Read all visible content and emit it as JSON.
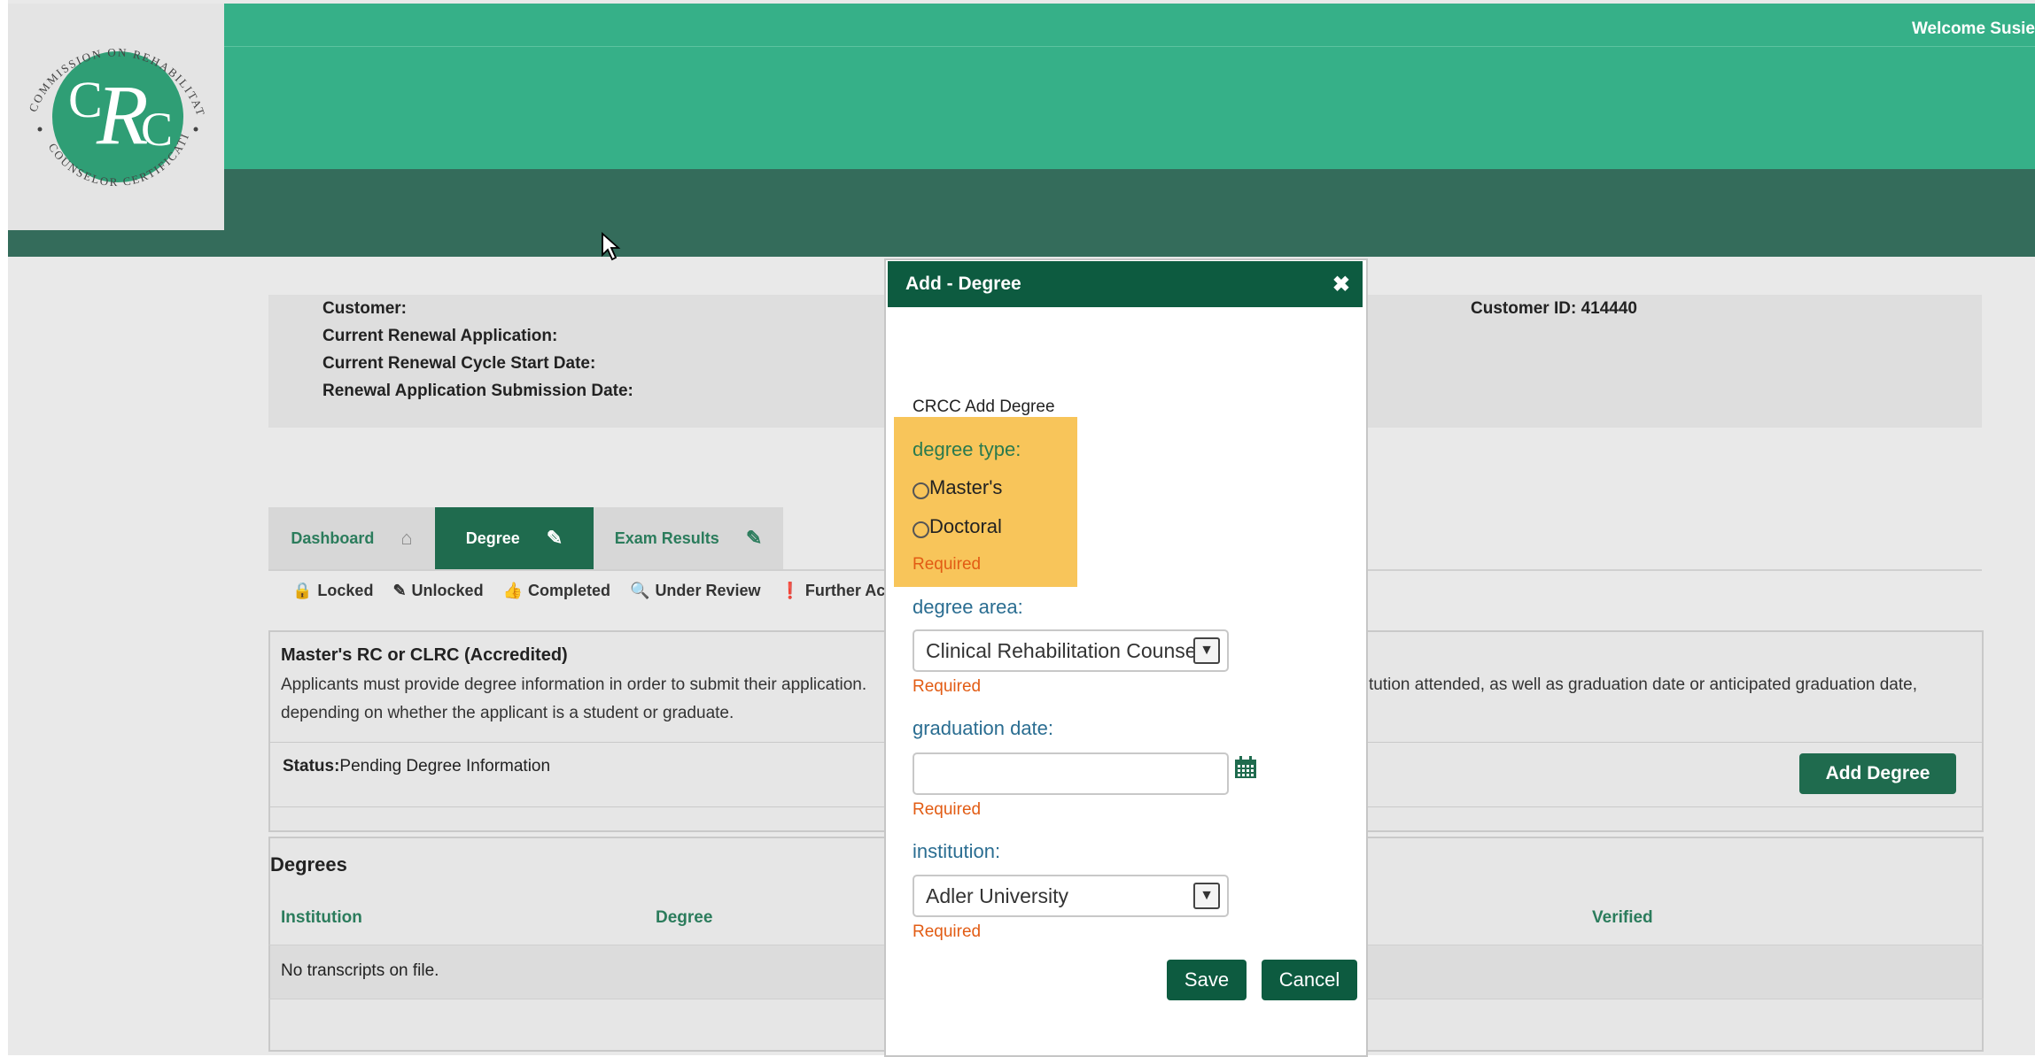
{
  "header": {
    "welcome": "Welcome Susie",
    "logo": {
      "top_text": "COMMISSION ON REHABILITATION",
      "bottom_text": "COUNSELOR CERTIFICATION",
      "monogram": "CRC",
      "colors": {
        "circle": "#2f9e75",
        "text": "#ffffff",
        "ring": "#444444"
      }
    }
  },
  "info": {
    "customer_label": "Customer:",
    "renewal_app_label": "Current Renewal Application:",
    "cycle_start_label": "Current Renewal Cycle Start Date:",
    "submission_label": "Renewal Application Submission Date:",
    "customer_id": "Customer ID: 414440"
  },
  "tabs": [
    {
      "label": "Dashboard",
      "icon": "home-icon"
    },
    {
      "label": "Degree",
      "icon": "pencil-icon",
      "active": true
    },
    {
      "label": "Exam Results",
      "icon": "pencil-icon"
    }
  ],
  "legend": [
    {
      "icon": "lock-icon",
      "glyph": "🔒",
      "label": "Locked"
    },
    {
      "icon": "pencil-icon",
      "glyph": "✎",
      "label": "Unlocked"
    },
    {
      "icon": "thumbs-up-icon",
      "glyph": "👍",
      "label": "Completed"
    },
    {
      "icon": "magnifier-icon",
      "glyph": "🔍",
      "label": "Under Review"
    },
    {
      "icon": "alert-icon",
      "glyph": "❗",
      "label": "Further Action"
    }
  ],
  "requirement": {
    "title": "Master's RC or CLRC (Accredited)",
    "desc_left": "Applicants must provide degree information in order to submit their application.",
    "desc_right": "tution attended, as well as graduation date or anticipated graduation date,",
    "desc_line2": "depending on whether the applicant is a student or graduate.",
    "status_label": "Status:",
    "status_value": "Pending Degree Information",
    "add_button": "Add Degree"
  },
  "degrees": {
    "title": "Degrees",
    "columns": {
      "institution": "Institution",
      "degree": "Degree",
      "verified": "Verified"
    },
    "empty_text": "No transcripts on file."
  },
  "modal": {
    "title": "Add - Degree",
    "close_glyph": "✖",
    "subtitle": "CRCC Add Degree",
    "degree_type_label": "degree type:",
    "options": [
      "Master's",
      "Doctoral"
    ],
    "required": "Required",
    "degree_area_label": "degree area:",
    "degree_area_value": "Clinical Rehabilitation Counseling",
    "graduation_label": "graduation date:",
    "graduation_value": "",
    "institution_label": "institution:",
    "institution_value": "Adler University",
    "save": "Save",
    "cancel": "Cancel"
  }
}
